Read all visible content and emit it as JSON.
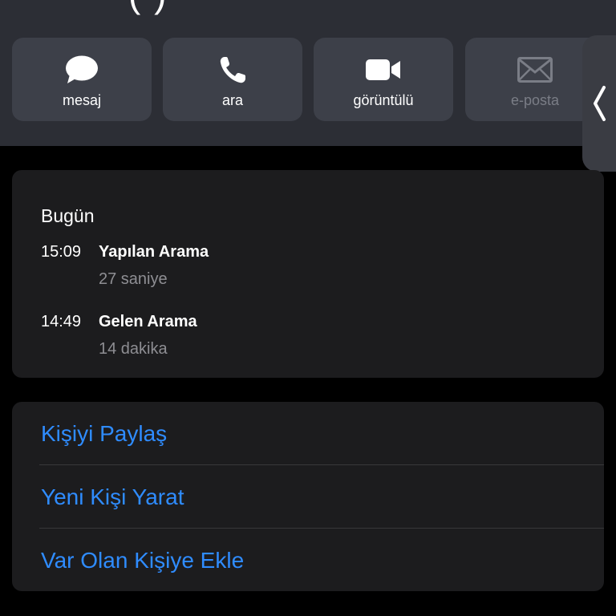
{
  "header": {
    "title_fragment": "(       )"
  },
  "actions": [
    {
      "label": "mesaj",
      "icon": "message-bubble-icon",
      "enabled": true
    },
    {
      "label": "ara",
      "icon": "phone-icon",
      "enabled": true
    },
    {
      "label": "görüntülü",
      "icon": "video-camera-icon",
      "enabled": true
    },
    {
      "label": "e-posta",
      "icon": "envelope-icon",
      "enabled": false
    }
  ],
  "history": {
    "heading": "Bugün",
    "calls": [
      {
        "time": "15:09",
        "type": "Yapılan Arama",
        "duration": "27 saniye"
      },
      {
        "time": "14:49",
        "type": "Gelen Arama",
        "duration": "14 dakika"
      }
    ]
  },
  "contact_actions": {
    "share": "Kişiyi Paylaş",
    "create": "Yeni Kişi Yarat",
    "add_existing": "Var Olan Kişiye Ekle"
  },
  "colors": {
    "link": "#2f8cff",
    "header_bg": "#2c2e35",
    "button_bg": "#3d4049",
    "card_bg": "#1c1c1e"
  }
}
